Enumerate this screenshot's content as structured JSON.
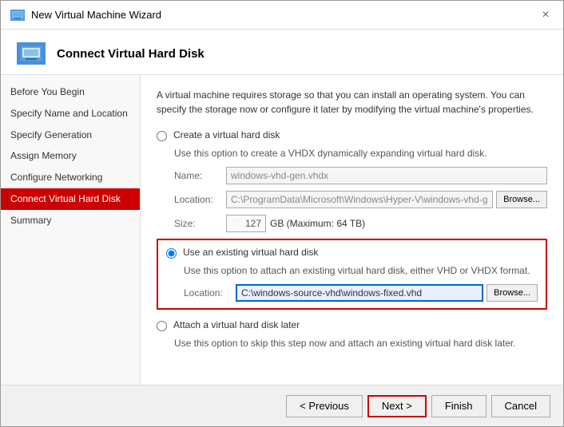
{
  "window": {
    "title": "New Virtual Machine Wizard",
    "close_label": "×"
  },
  "header": {
    "icon_label": "HD",
    "title": "Connect Virtual Hard Disk"
  },
  "sidebar": {
    "items": [
      {
        "id": "before-you-begin",
        "label": "Before You Begin",
        "active": false
      },
      {
        "id": "specify-name",
        "label": "Specify Name and Location",
        "active": false
      },
      {
        "id": "specify-generation",
        "label": "Specify Generation",
        "active": false
      },
      {
        "id": "assign-memory",
        "label": "Assign Memory",
        "active": false
      },
      {
        "id": "configure-networking",
        "label": "Configure Networking",
        "active": false
      },
      {
        "id": "connect-vhd",
        "label": "Connect Virtual Hard Disk",
        "active": true
      },
      {
        "id": "summary",
        "label": "Summary",
        "active": false
      }
    ]
  },
  "main": {
    "description": "A virtual machine requires storage so that you can install an operating system. You can specify the storage now or configure it later by modifying the virtual machine's properties.",
    "create_option": {
      "radio_label": "Create a virtual hard disk",
      "sub_text": "Use this option to create a VHDX dynamically expanding virtual hard disk.",
      "name_label": "Name:",
      "name_value": "windows-vhd-gen.vhdx",
      "location_label": "Location:",
      "location_value": "C:\\ProgramData\\Microsoft\\Windows\\Hyper-V\\windows-vhd-gen\\Vir",
      "browse_label": "Browse...",
      "size_label": "Size:",
      "size_value": "127",
      "size_suffix": "GB (Maximum: 64 TB)"
    },
    "existing_option": {
      "radio_label": "Use an existing virtual hard disk",
      "sub_text": "Use this option to attach an existing virtual hard disk, either VHD or VHDX format.",
      "location_label": "Location:",
      "location_value": "C:\\windows-source-vhd\\windows-fixed.vhd",
      "browse_label": "Browse..."
    },
    "attach_later_option": {
      "radio_label": "Attach a virtual hard disk later",
      "sub_text": "Use this option to skip this step now and attach an existing virtual hard disk later."
    }
  },
  "footer": {
    "previous_label": "< Previous",
    "next_label": "Next >",
    "finish_label": "Finish",
    "cancel_label": "Cancel"
  }
}
